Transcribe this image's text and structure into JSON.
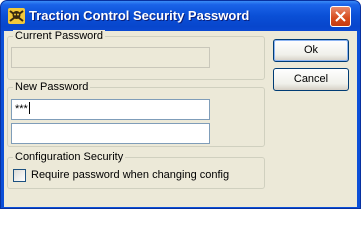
{
  "window": {
    "title": "Traction Control Security Password",
    "icon": "skull-crossbones-icon",
    "close_icon": "close-icon"
  },
  "current_password": {
    "group_label": "Current Password",
    "value": "",
    "disabled": true
  },
  "new_password": {
    "group_label": "New Password",
    "value": "***",
    "confirm_value": ""
  },
  "config_security": {
    "group_label": "Configuration Security",
    "checkbox_label": "Require password when changing config",
    "checked": false
  },
  "buttons": {
    "ok_label": "Ok",
    "cancel_label": "Cancel"
  },
  "colors": {
    "titlebar": "#0a4fd6",
    "face": "#ece9d8",
    "close": "#d64a1c"
  }
}
